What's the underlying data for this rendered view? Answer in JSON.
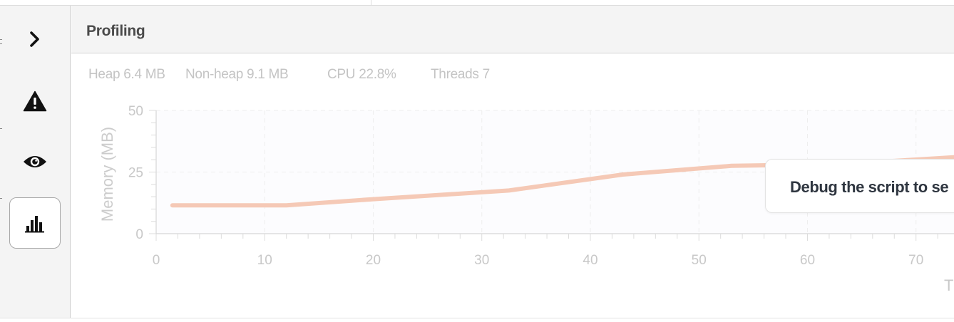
{
  "panel": {
    "title": "Profiling"
  },
  "stats": {
    "heap": "Heap 6.4 MB",
    "nonheap": "Non-heap 9.1 MB",
    "cpu": "CPU 22.8%",
    "threads": "Threads 7"
  },
  "rail": {
    "items": [
      {
        "icon": "chevron-right-icon",
        "active": false
      },
      {
        "icon": "warning-icon",
        "active": false
      },
      {
        "icon": "eye-icon",
        "active": false
      },
      {
        "icon": "bar-chart-icon",
        "active": true
      }
    ]
  },
  "tooltip": {
    "text": "Debug the script to se"
  },
  "chart_data": {
    "type": "line",
    "ylabel": "Memory (MB)",
    "xlabel": "T",
    "ylim": [
      0,
      50
    ],
    "xlim": [
      0,
      73.5
    ],
    "yticks": [
      0,
      25,
      50
    ],
    "xticks": [
      0,
      10,
      20,
      30,
      40,
      50,
      60,
      70
    ],
    "grid": true,
    "color": "#f5c9b6",
    "series": [
      {
        "x": [
          1.5,
          5,
          12,
          20,
          32.5,
          43,
          53,
          60,
          68,
          73.5
        ],
        "y": [
          11.5,
          11.5,
          11.5,
          14,
          17.5,
          24,
          27.5,
          28,
          29.5,
          31
        ]
      }
    ]
  }
}
